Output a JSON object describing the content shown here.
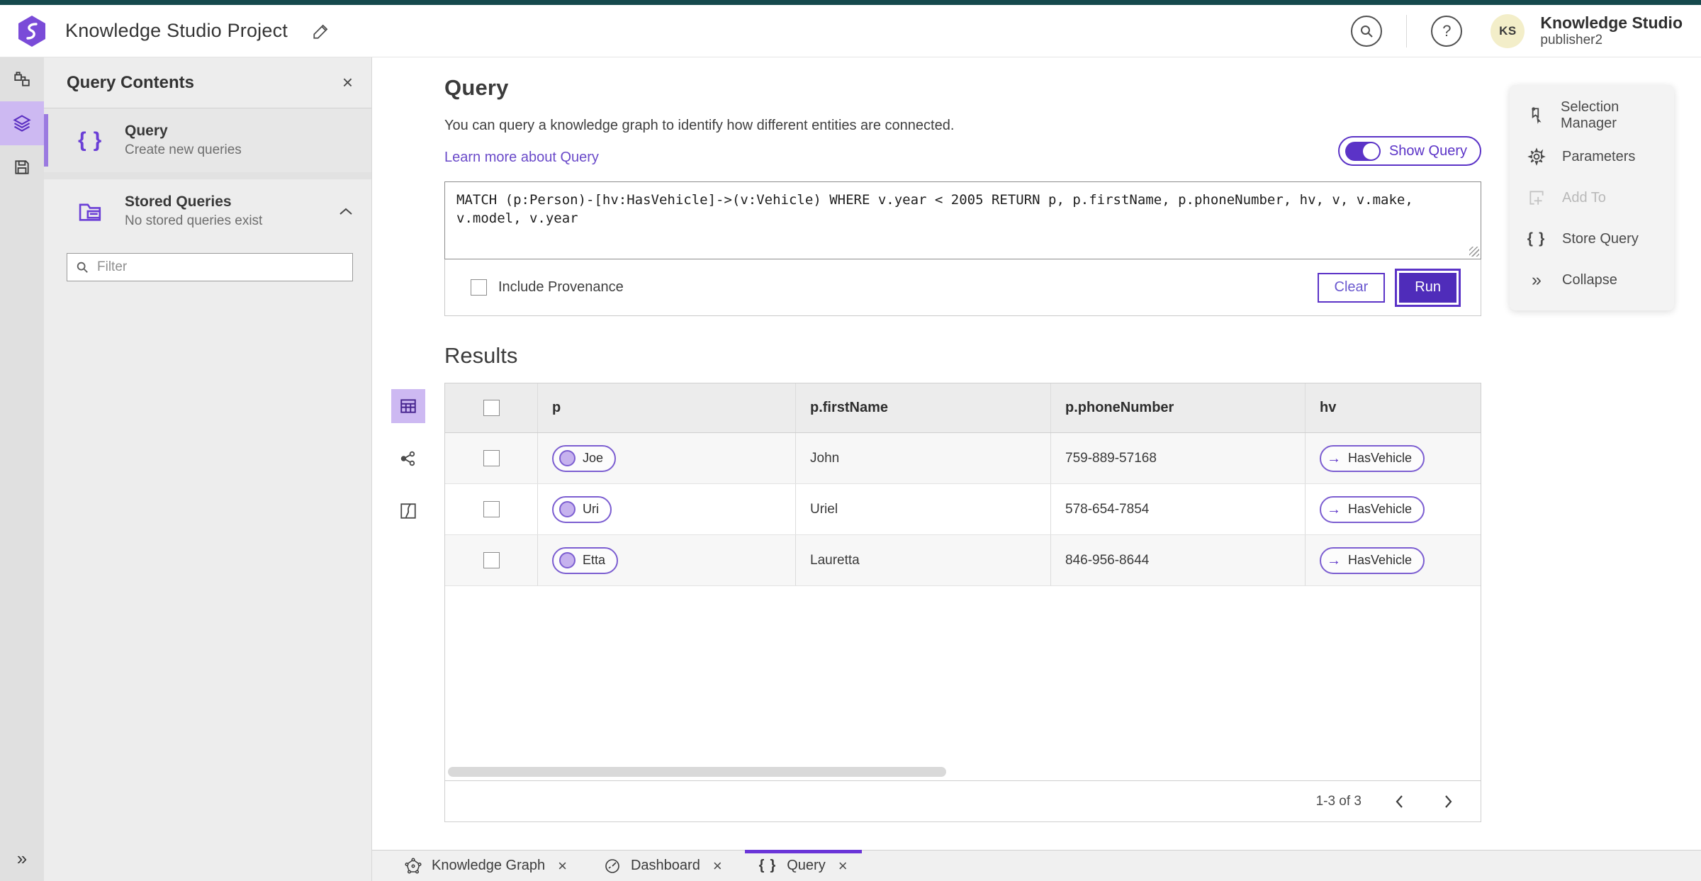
{
  "app": {
    "title": "Knowledge Studio Project",
    "user_name": "Knowledge Studio",
    "user_role": "publisher2",
    "avatar_initials": "KS"
  },
  "panel": {
    "title": "Query Contents",
    "query_item": {
      "title": "Query",
      "subtitle": "Create new queries"
    },
    "stored_item": {
      "title": "Stored Queries",
      "subtitle": "No stored queries exist"
    },
    "filter_placeholder": "Filter"
  },
  "query": {
    "title": "Query",
    "description": "You can query a knowledge graph to identify how different entities are connected.",
    "learn_more": "Learn more about Query",
    "show_query_label": "Show Query",
    "query_text": "MATCH (p:Person)-[hv:HasVehicle]->(v:Vehicle) WHERE v.year < 2005 RETURN p, p.firstName, p.phoneNumber, hv, v, v.make, v.model, v.year",
    "include_provenance_label": "Include Provenance",
    "clear_label": "Clear",
    "run_label": "Run"
  },
  "results": {
    "title": "Results",
    "columns": {
      "p": "p",
      "firstName": "p.firstName",
      "phoneNumber": "p.phoneNumber",
      "hv": "hv"
    },
    "rows": [
      {
        "p": "Joe",
        "firstName": "John",
        "phoneNumber": "759-889-57168",
        "hv": "HasVehicle"
      },
      {
        "p": "Uri",
        "firstName": "Uriel",
        "phoneNumber": "578-654-7854",
        "hv": "HasVehicle"
      },
      {
        "p": "Etta",
        "firstName": "Lauretta",
        "phoneNumber": "846-956-8644",
        "hv": "HasVehicle"
      }
    ],
    "pagination": "1-3 of 3"
  },
  "side_menu": {
    "selection_manager": "Selection Manager",
    "parameters": "Parameters",
    "add_to": "Add To",
    "store_query": "Store Query",
    "collapse": "Collapse"
  },
  "tabs": {
    "knowledge_graph": "Knowledge Graph",
    "dashboard": "Dashboard",
    "query": "Query"
  },
  "colors": {
    "accent_purple": "#5b33c7",
    "active_purple_bg": "#cdb9f2",
    "top_strip_teal": "#15494d",
    "link_purple": "#6a4ac9",
    "avatar_yellow": "#f3eec9"
  }
}
